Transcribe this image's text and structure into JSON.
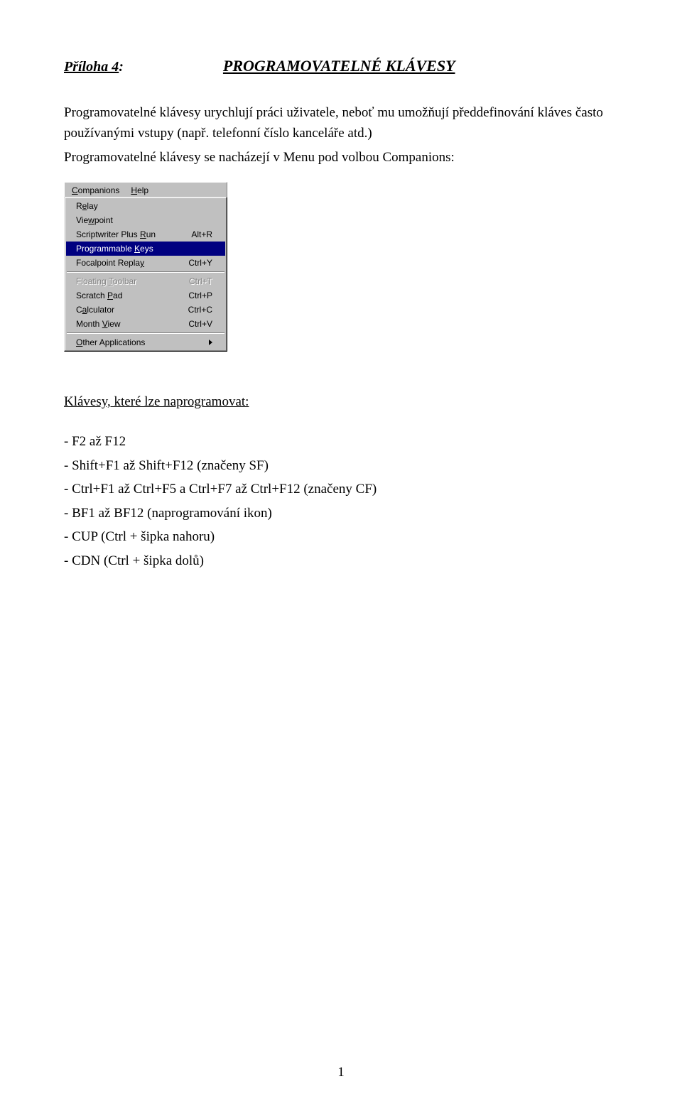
{
  "header": {
    "appendix_label": "Příloha 4",
    "title": "PROGRAMOVATELNÉ KLÁVESY"
  },
  "intro": {
    "p1": "Programovatelné klávesy urychlují práci uživatele, neboť mu umožňují předdefinování kláves často používanými vstupy (např. telefonní číslo kanceláře atd.)",
    "p2": "Programovatelné klávesy se nacházejí v Menu pod volbou Companions:"
  },
  "menu": {
    "menubar": {
      "companions_pre": "C",
      "companions_rest": "ompanions",
      "help_pre": "H",
      "help_rest": "elp"
    },
    "items": [
      {
        "label_pre": "R",
        "label_u": "e",
        "label_post": "lay",
        "shortcut": "",
        "state": "normal"
      },
      {
        "label_pre": "Vie",
        "label_u": "w",
        "label_post": "point",
        "shortcut": "",
        "state": "normal"
      },
      {
        "label_pre": "Scriptwriter Plus ",
        "label_u": "R",
        "label_post": "un",
        "shortcut": "Alt+R",
        "state": "normal"
      },
      {
        "label_pre": "Programmable ",
        "label_u": "K",
        "label_post": "eys",
        "shortcut": "",
        "state": "highlight"
      },
      {
        "label_pre": "Focalpoint Repla",
        "label_u": "y",
        "label_post": "",
        "shortcut": "Ctrl+Y",
        "state": "normal"
      }
    ],
    "items2": [
      {
        "label_pre": "Floating ",
        "label_u": "T",
        "label_post": "oolbar",
        "shortcut": "Ctrl+T",
        "state": "disabled"
      },
      {
        "label_pre": "Scratch ",
        "label_u": "P",
        "label_post": "ad",
        "shortcut": "Ctrl+P",
        "state": "normal"
      },
      {
        "label_pre": "C",
        "label_u": "a",
        "label_post": "lculator",
        "shortcut": "Ctrl+C",
        "state": "normal"
      },
      {
        "label_pre": "Month ",
        "label_u": "V",
        "label_post": "iew",
        "shortcut": "Ctrl+V",
        "state": "normal"
      }
    ],
    "items3": [
      {
        "label_pre": "",
        "label_u": "O",
        "label_post": "ther Applications",
        "shortcut": "",
        "state": "submenu"
      }
    ]
  },
  "section_heading": "Klávesy, které lze naprogramovat:",
  "key_list": {
    "l1": "- F2 až F12",
    "l2": "- Shift+F1 až Shift+F12 (značeny SF)",
    "l3": "- Ctrl+F1 až Ctrl+F5 a Ctrl+F7 až Ctrl+F12 (značeny CF)",
    "l4": "- BF1 až BF12 (naprogramování ikon)",
    "l5": "- CUP (Ctrl + šipka nahoru)",
    "l6": "- CDN (Ctrl + šipka dolů)"
  },
  "page_number": "1"
}
